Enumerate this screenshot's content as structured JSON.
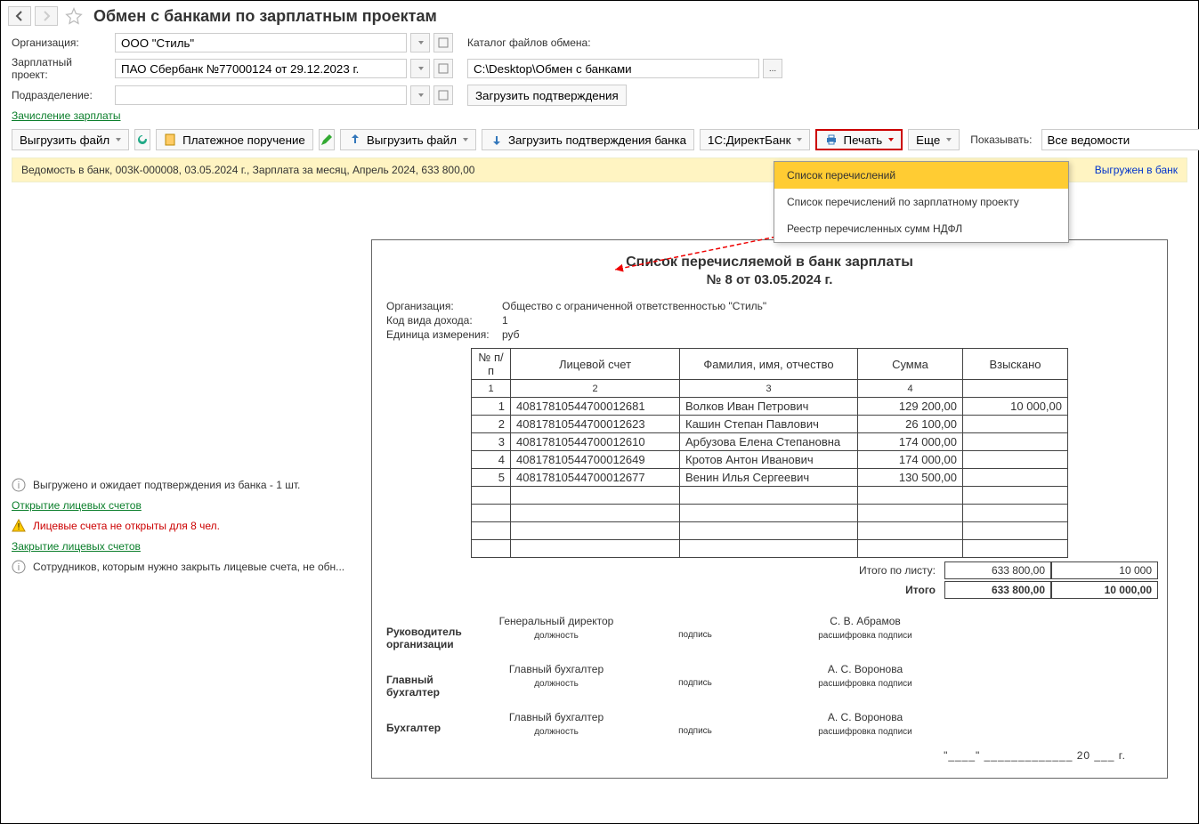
{
  "header": {
    "title": "Обмен с банками по зарплатным проектам"
  },
  "form": {
    "org_label": "Организация:",
    "org_value": "ООО \"Стиль\"",
    "project_label": "Зарплатный проект:",
    "project_value": "ПАО Сбербанк №77000124 от 29.12.2023 г.",
    "dept_label": "Подразделение:",
    "dept_value": "",
    "catalog_label": "Каталог файлов обмена:",
    "catalog_value": "C:\\Desktop\\Обмен с банками",
    "load_confirm_btn": "Загрузить подтверждения",
    "link_zachislenie": "Зачисление зарплаты"
  },
  "toolbar": {
    "upload": "Выгрузить файл",
    "payment_order": "Платежное поручение",
    "upload2": "Выгрузить файл",
    "load_bank": "Загрузить подтверждения банка",
    "direct_bank": "1С:ДиректБанк",
    "print": "Печать",
    "more": "Еще",
    "show_label": "Показывать:",
    "show_value": "Все ведомости"
  },
  "yellow": {
    "text": "Ведомость в банк, 003К-000008, 03.05.2024 г., Зарплата за месяц, Апрель 2024, 633 800,00",
    "status": "Выгружен в банк"
  },
  "menu": {
    "item1": "Список перечислений",
    "item2": "Список перечислений по зарплатному проекту",
    "item3": "Реестр перечисленных сумм НДФЛ"
  },
  "info": {
    "waiting": "Выгружено и ожидает подтверждения из банка - 1 шт.",
    "open_link": "Открытие лицевых счетов",
    "not_open": "Лицевые счета не открыты для 8 чел.",
    "close_link": "Закрытие лицевых счетов",
    "close_hint": "Сотрудников, которым нужно закрыть лицевые счета, не обн..."
  },
  "doc": {
    "title": "Список перечисляемой в банк зарплаты",
    "sub": "№  8 от 03.05.2024 г.",
    "meta": {
      "org_l": "Организация:",
      "org_v": "Общество с ограниченной ответственностью \"Стиль\"",
      "code_l": "Код вида дохода:",
      "code_v": "1",
      "unit_l": "Единица измерения:",
      "unit_v": "руб"
    },
    "cols": {
      "n": "№ п/п",
      "acc": "Лицевой счет",
      "fio": "Фамилия, имя, отчество",
      "sum": "Сумма",
      "vz": "Взыскано"
    },
    "nums": {
      "n": "1",
      "acc": "2",
      "fio": "3",
      "sum": "4"
    },
    "rows": [
      {
        "n": "1",
        "acc": "40817810544700012681",
        "fio": "Волков Иван Петрович",
        "sum": "129 200,00",
        "vz": "10 000,00"
      },
      {
        "n": "2",
        "acc": "40817810544700012623",
        "fio": "Кашин Степан Павлович",
        "sum": "26 100,00",
        "vz": ""
      },
      {
        "n": "3",
        "acc": "40817810544700012610",
        "fio": "Арбузова Елена Степановна",
        "sum": "174 000,00",
        "vz": ""
      },
      {
        "n": "4",
        "acc": "40817810544700012649",
        "fio": "Кротов Антон Иванович",
        "sum": "174 000,00",
        "vz": ""
      },
      {
        "n": "5",
        "acc": "40817810544700012677",
        "fio": "Венин Илья Сергеевич",
        "sum": "130 500,00",
        "vz": ""
      }
    ],
    "totals": {
      "sheet_l": "Итого по листу:",
      "sheet_sum": "633 800,00",
      "sheet_vz": "10 000",
      "grand_l": "Итого",
      "grand_sum": "633 800,00",
      "grand_vz": "10 000,00"
    },
    "sign": {
      "head_role": "Руководитель организации",
      "head_pos": "Генеральный директор",
      "head_name": "С. В. Абрамов",
      "acc_role": "Главный бухгалтер",
      "acc_pos": "Главный бухгалтер",
      "acc_name": "А. С. Воронова",
      "bk_role": "Бухгалтер",
      "bk_pos": "Главный бухгалтер",
      "bk_name": "А. С. Воронова",
      "cap_pos": "должность",
      "cap_sign": "подпись",
      "cap_ras": "расшифровка подписи",
      "date_tpl": "\"____\" _____________ 20 ___ г."
    }
  }
}
